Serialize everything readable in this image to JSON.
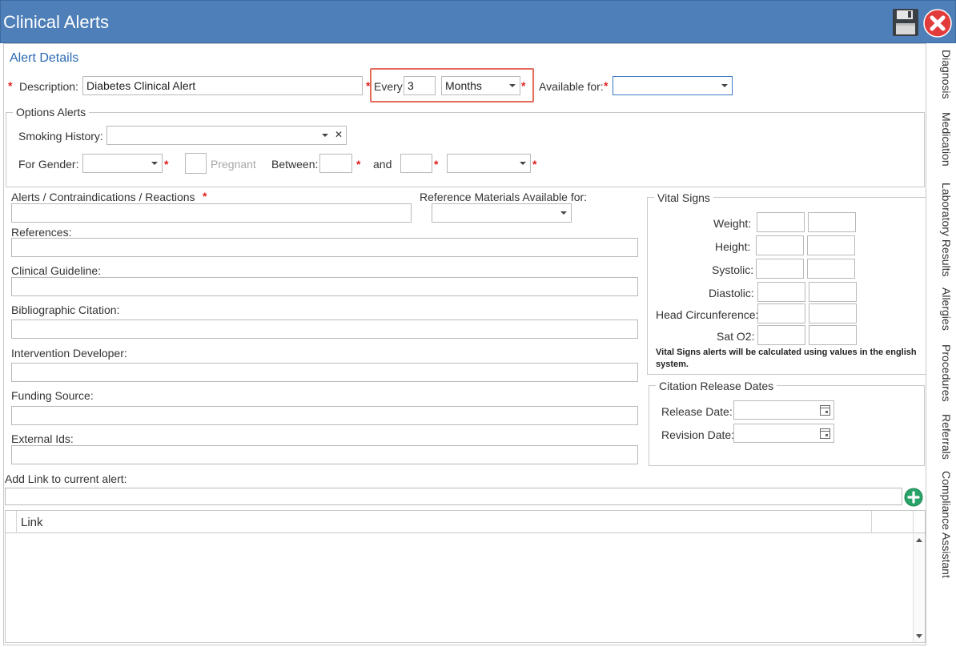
{
  "window": {
    "title": "Clinical Alerts",
    "save_icon": "floppy-disk-icon",
    "close_icon": "close-circle-icon",
    "accent": "#4e7fb8"
  },
  "alert_details": {
    "heading": "Alert Details",
    "description_label": "Description:",
    "description_value": "Diabetes Clinical Alert",
    "every_label": "Every:",
    "every_value": "3",
    "period_value": "Months",
    "available_label": "Available for:",
    "available_value": ""
  },
  "options": {
    "heading": "Options Alerts",
    "smoking_label": "Smoking History:",
    "smoking_value": "",
    "clear_glyph": "✕",
    "gender_label": "For Gender:",
    "gender_value": "",
    "pregnant_label": "Pregnant",
    "between_label": "Between:",
    "between_from": "",
    "and_label": "and",
    "between_to": "",
    "unit_value": ""
  },
  "fields": {
    "alerts_label": "Alerts / Contraindications / Reactions",
    "alerts_value": "",
    "refmat_label": "Reference Materials Available for:",
    "refmat_value": "",
    "references_label": "References:",
    "guideline_label": "Clinical Guideline:",
    "biblio_label": "Bibliographic Citation:",
    "developer_label": "Intervention Developer:",
    "funding_label": "Funding Source:",
    "external_label": "External Ids:"
  },
  "vital_signs": {
    "heading": "Vital Signs",
    "rows": [
      "Weight:",
      "Height:",
      "Systolic:",
      "Diastolic:",
      "Head Circunference:",
      "Sat O2:"
    ],
    "note": "Vital Signs alerts will be calculated using values in the english system."
  },
  "citation": {
    "heading": "Citation Release Dates",
    "release_label": "Release Date:",
    "release_value": "",
    "revision_label": "Revision Date:",
    "revision_value": ""
  },
  "link": {
    "add_label": "Add Link to current alert:",
    "link_value": "",
    "column_header": "Link",
    "add_icon": "plus-circle-icon"
  },
  "side_tabs": [
    "Diagnosis",
    "Medication",
    "Laboratory Results",
    "Allergies",
    "Procedures",
    "Referrals",
    "Compliance Assistant"
  ]
}
